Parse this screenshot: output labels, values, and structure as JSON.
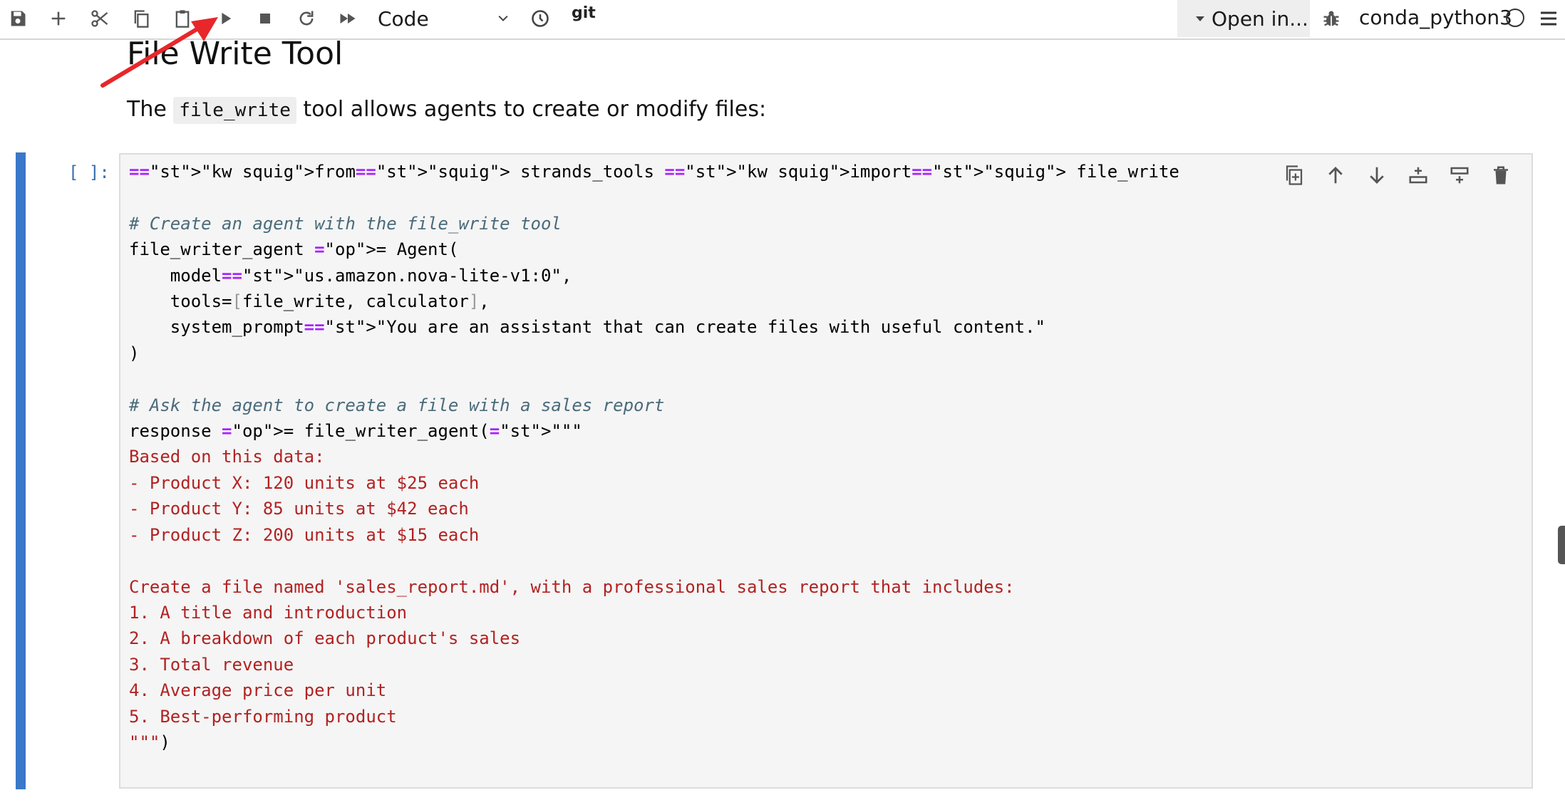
{
  "toolbar": {
    "cell_type": "Code",
    "git_label": "git",
    "open_in_label": "Open in...",
    "kernel_name": "conda_python3",
    "icons": [
      "save-icon",
      "plus-icon",
      "cut-icon",
      "copy-icon",
      "paste-icon",
      "run-icon",
      "stop-icon",
      "restart-icon",
      "run-all-icon",
      "history-icon"
    ]
  },
  "markdown": {
    "title": "File Write Tool",
    "para_before": "The ",
    "para_code": "file_write",
    "para_after": " tool allows agents to create or modify files:"
  },
  "cell": {
    "prompt": "[ ]:",
    "lines": [
      "from strands_tools import file_write",
      "",
      "# Create an agent with the file_write tool",
      "file_writer_agent = Agent(",
      "    model=\"us.amazon.nova-lite-v1:0\",",
      "    tools=[file_write, calculator],",
      "    system_prompt=\"You are an assistant that can create files with useful content.\"",
      ")",
      "",
      "# Ask the agent to create a file with a sales report",
      "response = file_writer_agent(\"\"\"",
      "Based on this data:",
      "- Product X: 120 units at $25 each",
      "- Product Y: 85 units at $42 each",
      "- Product Z: 200 units at $15 each",
      "",
      "Create a file named 'sales_report.md', with a professional sales report that includes:",
      "1. A title and introduction",
      "2. A breakdown of each product's sales",
      "3. Total revenue",
      "4. Average price per unit",
      "5. Best-performing product",
      "\"\"\")"
    ],
    "tools": [
      "duplicate-cell-icon",
      "move-up-icon",
      "move-down-icon",
      "insert-below-icon",
      "insert-above-icon",
      "delete-icon"
    ]
  },
  "colors": {
    "cell_bar": "#3a78c9",
    "keyword": "#2a8000",
    "string": "#b22222",
    "comment": "#4a6b7a",
    "annotation_arrow": "#e8272a"
  }
}
